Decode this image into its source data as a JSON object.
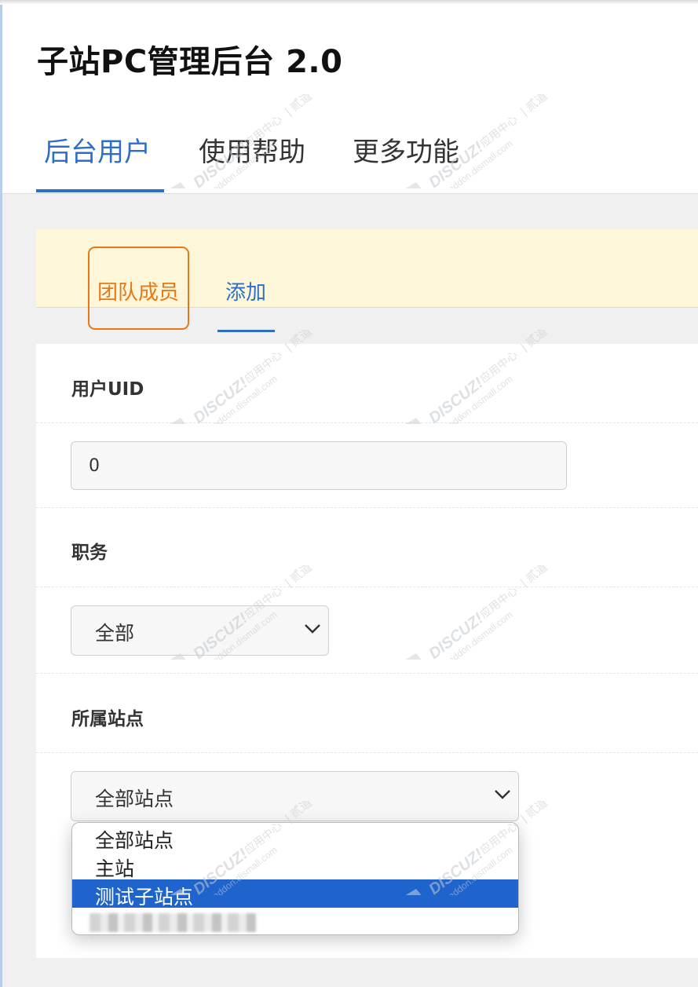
{
  "app": {
    "title": "子站PC管理后台 2.0"
  },
  "nav": {
    "tabs": [
      {
        "label": "后台用户",
        "active": true
      },
      {
        "label": "使用帮助",
        "active": false
      },
      {
        "label": "更多功能",
        "active": false
      }
    ]
  },
  "subnav": {
    "tabs": [
      {
        "label": "团队成员",
        "highlighted": true
      },
      {
        "label": "添加",
        "active": true
      }
    ]
  },
  "form": {
    "uid": {
      "label": "用户UID",
      "value": "0"
    },
    "role": {
      "label": "职务",
      "selected": "全部"
    },
    "site": {
      "label": "所属站点",
      "selected": "全部站点"
    }
  },
  "dropdown": {
    "options": [
      "全部站点",
      "主站",
      "测试子站点"
    ],
    "highlighted_option": "测试子站点"
  },
  "watermark": {
    "brand": "DISCUZ!",
    "line1": "应用中心",
    "line2": "贰道",
    "url": "addon.dismall.com"
  },
  "colors": {
    "accent": "#2c6fc4",
    "highlight": "#e77817",
    "subbar_bg": "#fef6d8",
    "option_selected": "#1e64cc"
  }
}
